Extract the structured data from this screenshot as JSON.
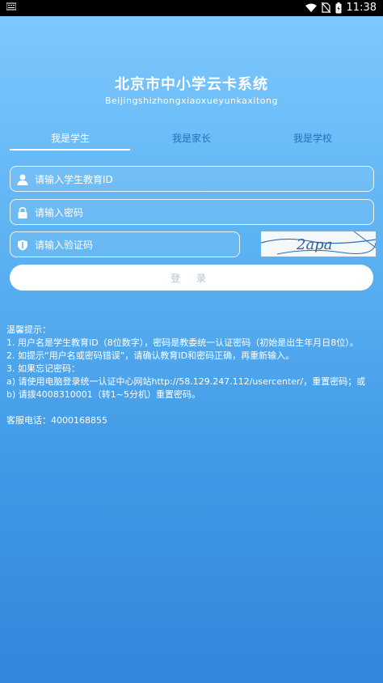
{
  "status_bar": {
    "time": "11:38",
    "left_icon": "notification-icon",
    "icons": [
      "wifi-icon",
      "no-sim-icon",
      "battery-icon"
    ]
  },
  "header": {
    "title": "北京市中小学云卡系统",
    "subtitle": "Beijingshizhongxiaoxueyunkaxitong"
  },
  "tabs": [
    {
      "label": "我是学生",
      "active": true
    },
    {
      "label": "我是家长",
      "active": false
    },
    {
      "label": "我是学校",
      "active": false
    }
  ],
  "form": {
    "student_id": {
      "placeholder": "请输入学生教育ID",
      "value": ""
    },
    "password": {
      "placeholder": "请输入密码",
      "value": ""
    },
    "captcha": {
      "placeholder": "请输入验证码",
      "value": ""
    },
    "captcha_image_text": "2apa",
    "login_label": "登 录"
  },
  "tips": {
    "heading": "温馨提示：",
    "line1": "1. 用户名是学生教育ID（8位数字），密码是教委统一认证密码（初始是出生年月日8位）。",
    "line2": "2. 如提示“用户名或密码错误”，请确认教育ID和密码正确，再重新输入。",
    "line3": "3. 如果忘记密码：",
    "line4": "a) 请使用电脑登录统一认证中心网站http://58.129.247.112/usercenter/，重置密码；或",
    "line5": "b) 请拨4008310001（转1~5分机）重置密码。",
    "phone": "客服电话：4000168855"
  },
  "colors": {
    "background_top": "#7fc9ff",
    "background_bottom": "#3586dd",
    "inactive_tab": "#2a6fb6",
    "login_text": "#b4c2cf"
  }
}
